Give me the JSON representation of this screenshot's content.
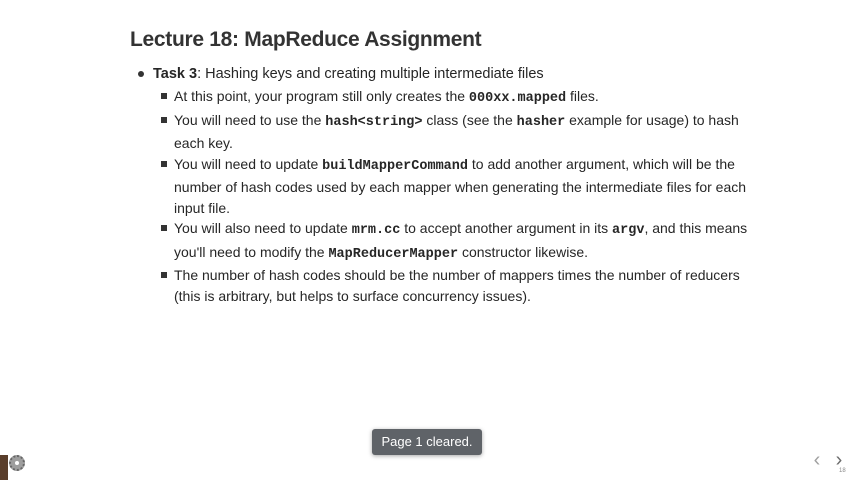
{
  "slide": {
    "title": "Lecture 18: MapReduce Assignment",
    "task": {
      "label": "Task 3",
      "text": ": Hashing keys and creating multiple intermediate files"
    },
    "items": [
      {
        "t1": "At this point, your program still only creates the ",
        "c1": "000xx.mapped",
        "t2": " files."
      },
      {
        "t1": "You will need to use the ",
        "c1": "hash<string>",
        "t2": " class (see the ",
        "c2": "hasher",
        "t3": " example for usage) to hash each key."
      },
      {
        "t1": "You will need to update ",
        "c1": "buildMapperCommand",
        "t2": " to add another argument, which will be the number of hash codes used by each mapper when generating the intermediate files for each input file."
      },
      {
        "t1": "You will also need to update ",
        "c1": "mrm.cc",
        "t2": " to accept another argument in its ",
        "c2": "argv",
        "t3": ", and this means you'll need to modify the ",
        "c3": "MapReducerMapper",
        "t4": " constructor likewise."
      },
      {
        "t1": " The number of hash codes should be the number of mappers times the number of reducers (this is arbitrary, but helps to surface concurrency issues)."
      }
    ],
    "slide_number": "18"
  },
  "toast": {
    "text": "Page 1 cleared."
  },
  "nav": {
    "prev_icon": "‹",
    "next_icon": "›"
  },
  "colors": {
    "toast_bg": "#5f6368",
    "text": "#262626"
  }
}
